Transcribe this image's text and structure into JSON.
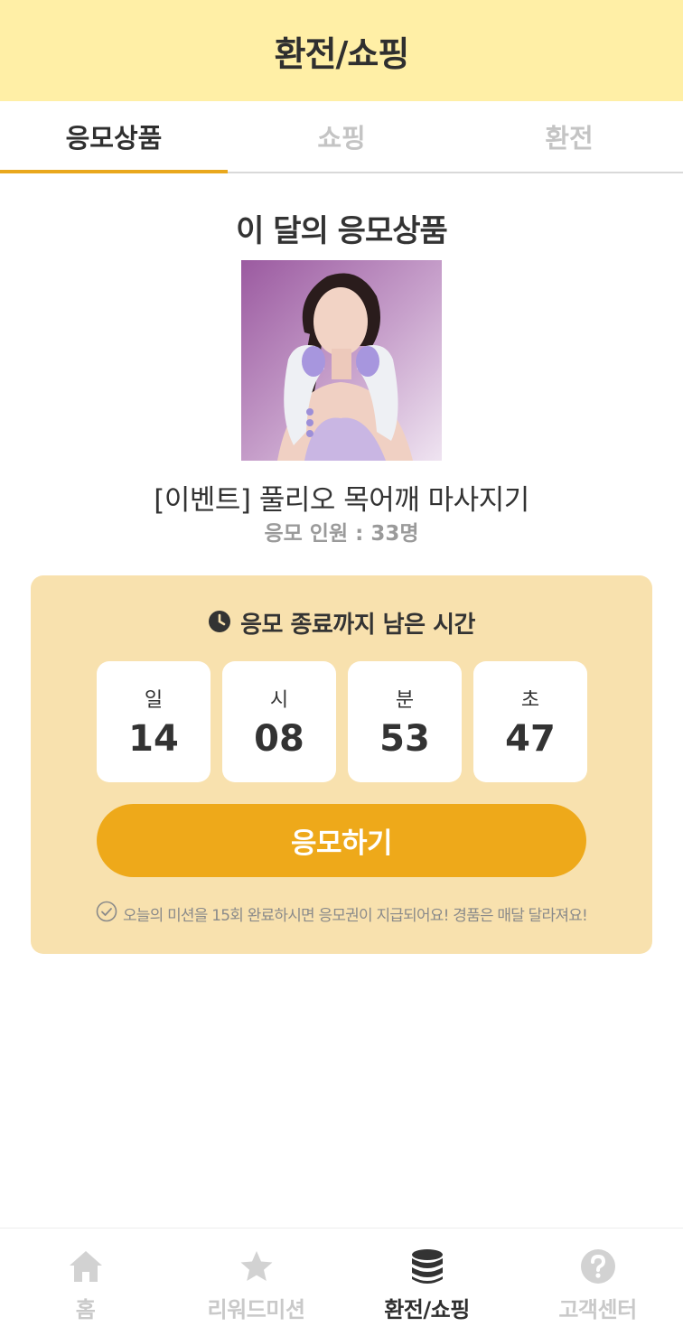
{
  "header": {
    "title": "환전/쇼핑"
  },
  "tabs": [
    {
      "label": "응모상품",
      "active": true
    },
    {
      "label": "쇼핑",
      "active": false
    },
    {
      "label": "환전",
      "active": false
    }
  ],
  "main": {
    "section_title": "이 달의 응모상품",
    "product_name": "[이벤트] 풀리오 목어깨 마사지기",
    "applicants": "응모 인원 : 33명",
    "timer": {
      "label": "응모 종료까지 남은 시간",
      "units": [
        {
          "unit": "일",
          "value": "14"
        },
        {
          "unit": "시",
          "value": "08"
        },
        {
          "unit": "분",
          "value": "53"
        },
        {
          "unit": "초",
          "value": "47"
        }
      ]
    },
    "apply_button": "응모하기",
    "notice": "오늘의 미션을 15회 완료하시면 응모권이 지급되어요! 경품은 매달 달라져요!"
  },
  "bottom_nav": [
    {
      "label": "홈",
      "icon": "home-icon",
      "active": false
    },
    {
      "label": "리워드미션",
      "icon": "star-icon",
      "active": false
    },
    {
      "label": "환전/쇼핑",
      "icon": "coins-icon",
      "active": true
    },
    {
      "label": "고객센터",
      "icon": "help-icon",
      "active": false
    }
  ],
  "colors": {
    "header_bg": "#FFEFA6",
    "accent": "#EEA91A",
    "panel_bg": "#F8E1AE"
  }
}
